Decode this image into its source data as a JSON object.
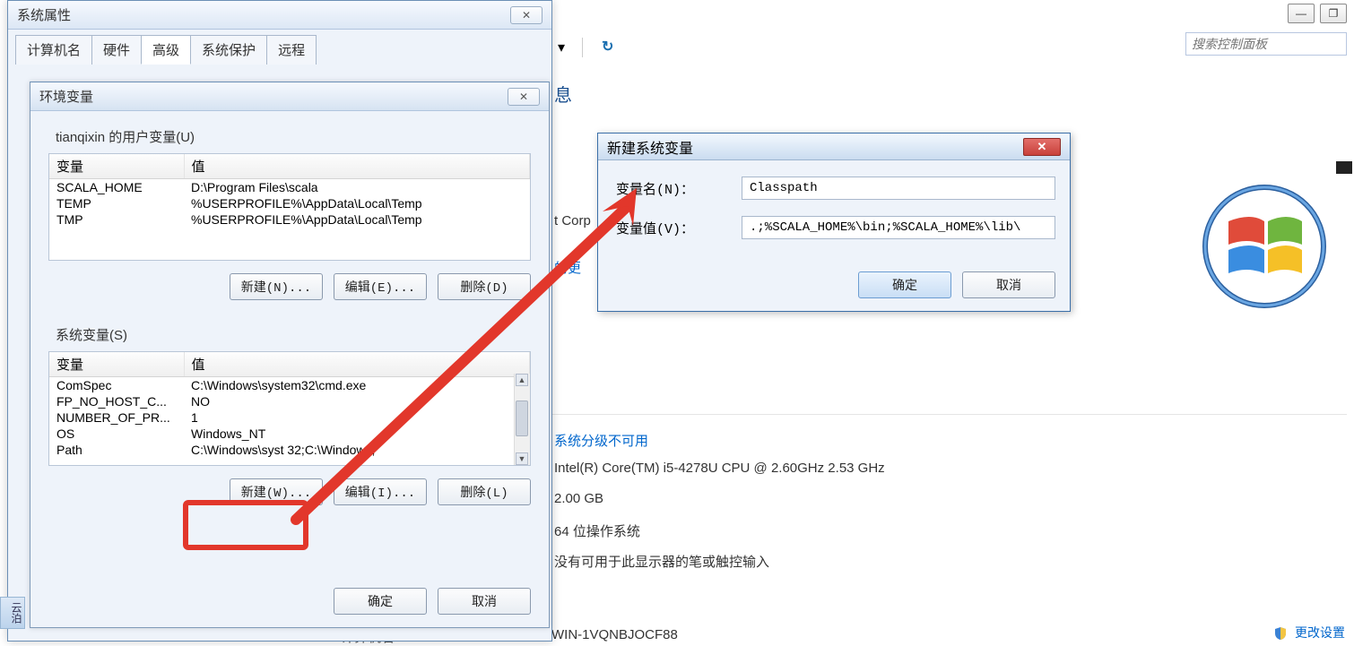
{
  "window_controls": {
    "minimize": "—",
    "maximize": "❐"
  },
  "search": {
    "placeholder": "搜索控制面板"
  },
  "bg": {
    "heading_fragment": "息",
    "corp_fragment": "t Corp",
    "update_fragment": "的更",
    "rating_link": "系统分级不可用",
    "cpu": "Intel(R) Core(TM) i5-4278U CPU @ 2.60GHz   2.53 GHz",
    "ram": "2.00 GB",
    "os_type": "64 位操作系统",
    "pen": "没有可用于此显示器的笔或触控输入",
    "computer_name_label": "计算机名:",
    "computer_name_value": "WIN-1VQNBJOCF88",
    "change_settings": "更改设置"
  },
  "sysprops": {
    "title": "系统属性",
    "tabs": [
      "计算机名",
      "硬件",
      "高级",
      "系统保护",
      "远程"
    ],
    "active_tab": 2
  },
  "envvars": {
    "title": "环境变量",
    "user_label": "tianqixin 的用户变量(U)",
    "sys_label": "系统变量(S)",
    "col_var": "变量",
    "col_val": "值",
    "user_rows": [
      {
        "name": "SCALA_HOME",
        "value": "D:\\Program Files\\scala"
      },
      {
        "name": "TEMP",
        "value": "%USERPROFILE%\\AppData\\Local\\Temp"
      },
      {
        "name": "TMP",
        "value": "%USERPROFILE%\\AppData\\Local\\Temp"
      }
    ],
    "sys_rows": [
      {
        "name": "ComSpec",
        "value": "C:\\Windows\\system32\\cmd.exe"
      },
      {
        "name": "FP_NO_HOST_C...",
        "value": "NO"
      },
      {
        "name": "NUMBER_OF_PR...",
        "value": "1"
      },
      {
        "name": "OS",
        "value": "Windows_NT"
      },
      {
        "name": "Path",
        "value": "C:\\Windows\\syst    32;C:\\Windows;"
      }
    ],
    "buttons": {
      "new_n": "新建(N)...",
      "edit_e": "编辑(E)...",
      "delete_d": "删除(D)",
      "new_w": "新建(W)...",
      "edit_i": "编辑(I)...",
      "delete_l": "删除(L)",
      "ok": "确定",
      "cancel": "取消"
    }
  },
  "newvar": {
    "title": "新建系统变量",
    "name_label": "变量名(N)：",
    "value_label": "变量值(V)：",
    "name_field": "Classpath",
    "value_field": ".;%SCALA_HOME%\\bin;%SCALA_HOME%\\lib\\",
    "ok": "确定",
    "cancel": "取消"
  },
  "taskbar_fragment": "云泊"
}
